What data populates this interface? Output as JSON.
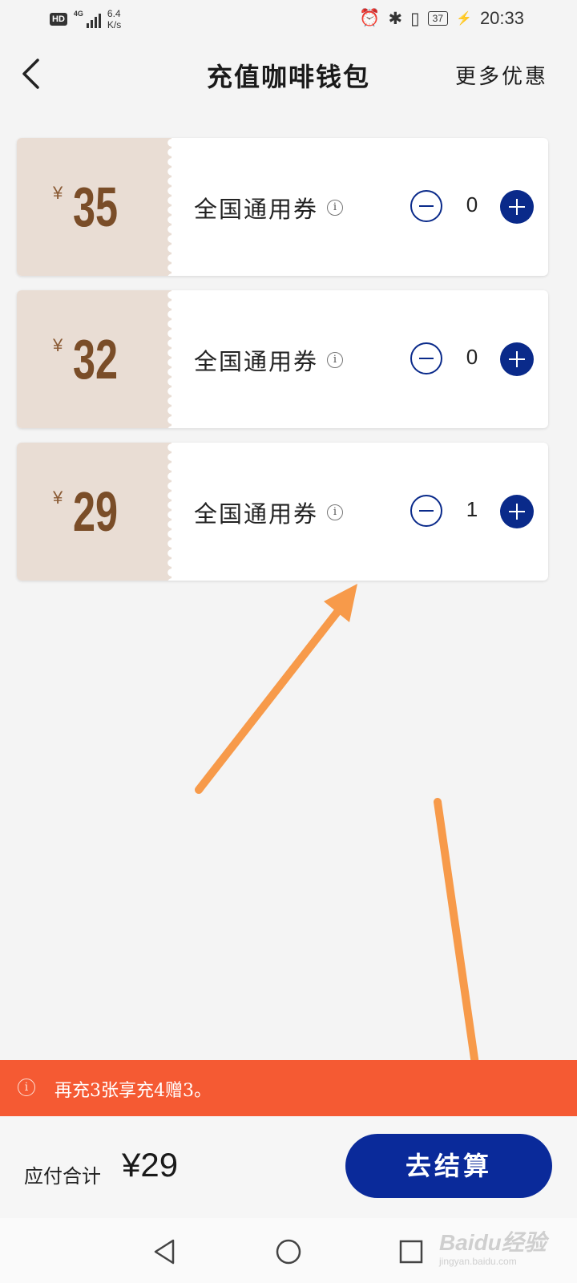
{
  "status_bar": {
    "hd": "HD",
    "network": "4G",
    "speed_value": "6.4",
    "speed_unit": "K/s",
    "battery": "37",
    "time": "20:33"
  },
  "header": {
    "title": "充值咖啡钱包",
    "right_action": "更多优惠"
  },
  "coupons": [
    {
      "currency": "¥",
      "price": "35",
      "name": "全国通用券",
      "quantity": "0"
    },
    {
      "currency": "¥",
      "price": "32",
      "name": "全国通用券",
      "quantity": "0"
    },
    {
      "currency": "¥",
      "price": "29",
      "name": "全国通用券",
      "quantity": "1"
    }
  ],
  "promo": {
    "text": "再充3张享充4赠3。"
  },
  "checkout": {
    "total_label": "应付合计",
    "total_amount": "¥29",
    "button_label": "去结算"
  },
  "watermark": {
    "main": "Baidu经验",
    "sub": "jingyan.baidu.com"
  },
  "colors": {
    "accent_blue": "#0a2a9a",
    "promo_orange": "#f55a33",
    "stub_beige": "#e9ddd4",
    "price_brown": "#7a4d28",
    "annotation_arrow": "#f79a4a"
  }
}
